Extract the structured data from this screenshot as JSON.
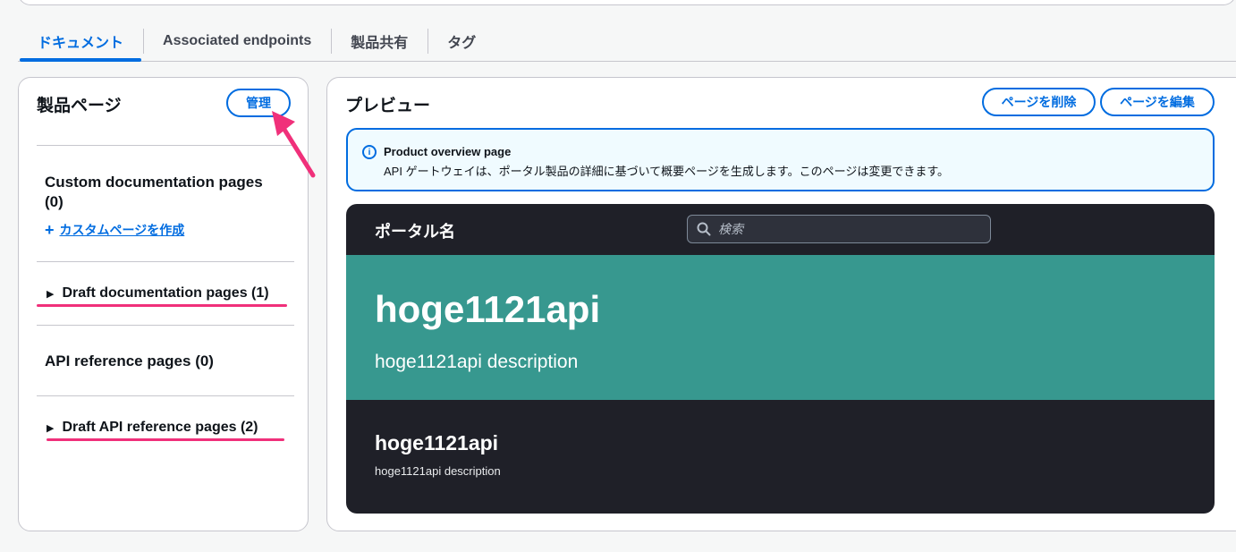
{
  "tabs": [
    {
      "label": "ドキュメント",
      "active": true
    },
    {
      "label": "Associated endpoints",
      "active": false
    },
    {
      "label": "製品共有",
      "active": false
    },
    {
      "label": "タグ",
      "active": false
    }
  ],
  "left_panel": {
    "title": "製品ページ",
    "manage_button": "管理",
    "custom_docs_heading": "Custom documentation pages",
    "custom_docs_count": "(0)",
    "create_link": "カスタムページを作成",
    "draft_docs": "Draft documentation pages (1)",
    "api_ref_heading": "API reference pages (0)",
    "draft_api_ref": "Draft API reference pages (2)"
  },
  "right_panel": {
    "title": "プレビュー",
    "delete_button": "ページを削除",
    "edit_button": "ページを編集",
    "alert": {
      "icon": "info-icon",
      "title": "Product overview page",
      "body": "API ゲートウェイは、ポータル製品の詳細に基づいて概要ページを生成します。このページは変更できます。"
    },
    "preview": {
      "portal_name": "ポータル名",
      "search_placeholder": "検索",
      "hero_title": "hoge1121api",
      "hero_description": "hoge1121api description",
      "card_title": "hoge1121api",
      "card_description": "hoge1121api description"
    }
  },
  "colors": {
    "accent": "#006ce0",
    "annotation": "#f0307a",
    "preview_bg": "#1f2028",
    "hero_bg": "#37988f"
  }
}
